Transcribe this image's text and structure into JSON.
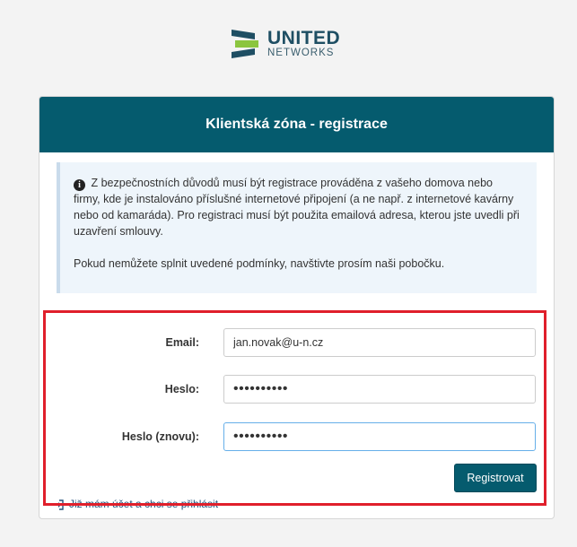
{
  "logo": {
    "line1": "UNITED",
    "line2": "NETWORKS"
  },
  "header": {
    "title": "Klientská zóna - registrace"
  },
  "info": {
    "icon": "info-circle-icon",
    "paragraph1": "Z bezpečnostních důvodů musí být registrace prováděna z vašeho domova nebo firmy, kde je instalováno příslušné internetové připojení (a ne např. z internetové kavárny nebo od kamaráda). Pro registraci musí být použita emailová adresa, kterou jste uvedli při uzavření smlouvy.",
    "paragraph2": "Pokud nemůžete splnit uvedené podmínky, navštivte prosím naši pobočku."
  },
  "form": {
    "email_label": "Email:",
    "email_value": "jan.novak@u-n.cz",
    "password_label": "Heslo:",
    "password_value": "••••••••••",
    "password_again_label": "Heslo (znovu):",
    "password_again_value": "••••••••••",
    "submit_label": "Registrovat"
  },
  "login_link": {
    "icon": "sign-in-icon",
    "label": "Již mám účet a chci se přihlásit"
  },
  "colors": {
    "brand": "#055b6e",
    "highlight": "#e01f2b",
    "info_bg": "#eef5fb"
  }
}
